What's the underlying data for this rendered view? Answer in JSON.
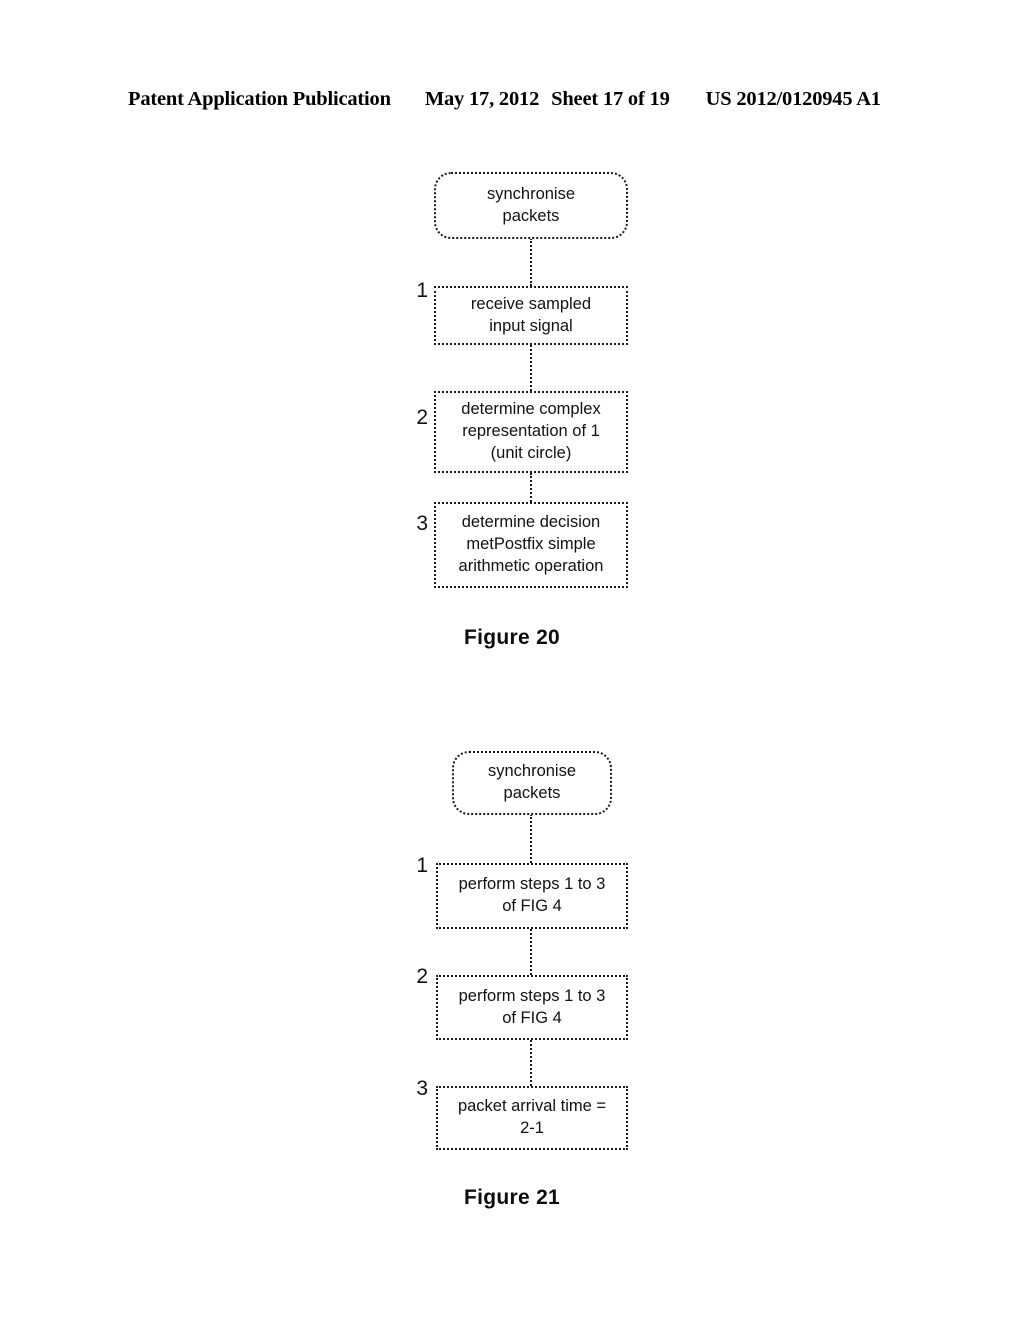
{
  "header": {
    "publication": "Patent Application Publication",
    "date": "May 17, 2012",
    "sheet": "Sheet 17 of 19",
    "patent_number": "US 2012/0120945 A1"
  },
  "figures": [
    {
      "caption": "Figure 20",
      "nodes": [
        {
          "id": "fig20-start",
          "shape": "terminal",
          "step": "",
          "text": "synchronise\npackets"
        },
        {
          "id": "fig20-step1",
          "shape": "rect",
          "step": "1",
          "text": "receive sampled\ninput signal"
        },
        {
          "id": "fig20-step2",
          "shape": "rect",
          "step": "2",
          "text": "determine complex\nrepresentation of 1\n(unit circle)"
        },
        {
          "id": "fig20-step3",
          "shape": "rect",
          "step": "3",
          "text": "determine decision\nmetPostfix  simple\narithmetic operation"
        }
      ]
    },
    {
      "caption": "Figure 21",
      "nodes": [
        {
          "id": "fig21-start",
          "shape": "terminal",
          "step": "",
          "text": "synchronise\npackets"
        },
        {
          "id": "fig21-step1",
          "shape": "rect",
          "step": "1",
          "text": "perform steps 1 to 3\nof FIG 4"
        },
        {
          "id": "fig21-step2",
          "shape": "rect",
          "step": "2",
          "text": "perform steps 1 to 3\nof FIG 4"
        },
        {
          "id": "fig21-step3",
          "shape": "rect",
          "step": "3",
          "text": "packet arrival time =\n2-1"
        }
      ]
    }
  ]
}
